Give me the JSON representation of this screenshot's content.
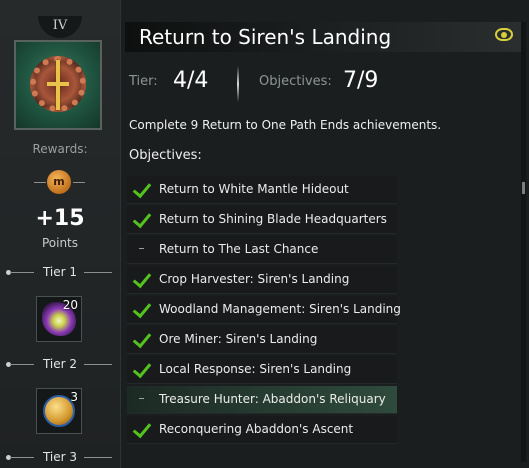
{
  "sidebar": {
    "tier_roman": "IV",
    "rewards_label": "Rewards:",
    "coin_icon_text": "m",
    "points_value": "+15",
    "points_label": "Points",
    "tier1_label": "Tier 1",
    "tier2_label": "Tier 2",
    "tier3_label": "Tier 3",
    "tier1_reward_count": "20",
    "tier2_reward_count": "3",
    "reward_icons": [
      "mastery-point-icon",
      "wings-item-icon",
      "gold-coin-item-icon"
    ]
  },
  "header": {
    "title": "Return to Siren's Landing",
    "eye_icon": "eye-icon"
  },
  "stats": {
    "tier_label": "Tier:",
    "tier_value": "4/4",
    "objectives_label": "Objectives:",
    "objectives_value": "7/9"
  },
  "description": "Complete 9 Return to One Path Ends achievements.",
  "objectives_heading": "Objectives:",
  "objectives": [
    {
      "label": "Return to White Mantle Hideout",
      "done": true
    },
    {
      "label": "Return to Shining Blade Headquarters",
      "done": true
    },
    {
      "label": "Return to The Last Chance",
      "done": false
    },
    {
      "label": "Crop Harvester: Siren's Landing",
      "done": true
    },
    {
      "label": "Woodland Management: Siren's Landing",
      "done": true
    },
    {
      "label": "Ore Miner: Siren's Landing",
      "done": true
    },
    {
      "label": "Local Response: Siren's Landing",
      "done": true
    },
    {
      "label": "Treasure Hunter: Abaddon's Reliquary",
      "done": false
    },
    {
      "label": "Reconquering Abaddon's Ascent",
      "done": true
    }
  ],
  "colors": {
    "check_green": "#54c21e",
    "eye_yellow": "#d6cf3c",
    "background": "#1b1e1f"
  }
}
